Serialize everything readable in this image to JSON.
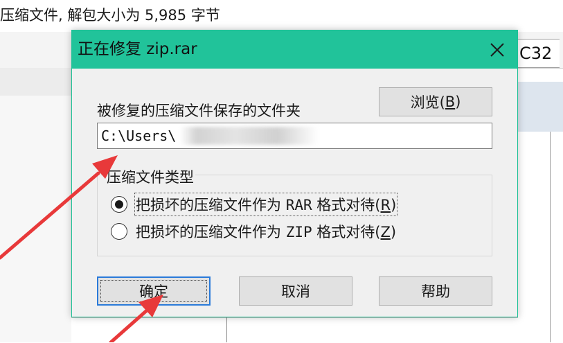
{
  "background": {
    "status_text": "压缩文件, 解包大小为 5,985 字节",
    "crc_column": "C32"
  },
  "dialog": {
    "title": "正在修复 zip.rar",
    "close_icon": "close-icon",
    "folder_label": "被修复的压缩文件保存的文件夹",
    "browse_button": {
      "label": "浏览(",
      "accel": "B",
      "suffix": ")"
    },
    "path_value": "C:\\Users\\",
    "archive_type": {
      "legend": "压缩文件类型",
      "options": [
        {
          "label": "把损坏的压缩文件作为 ",
          "format": "RAR",
          "rest": " 格式对待(",
          "accel": "R",
          "suffix": ")",
          "selected": true
        },
        {
          "label": "把损坏的压缩文件作为 ",
          "format": "ZIP",
          "rest": " 格式对待(",
          "accel": "Z",
          "suffix": ")",
          "selected": false
        }
      ]
    },
    "buttons": {
      "ok": "确定",
      "cancel": "取消",
      "help": "帮助"
    }
  },
  "colors": {
    "titlebar": "#21c39a",
    "dialog_bg": "#f0f0f0",
    "focus_border": "#2a7ad9",
    "annotation_arrow": "#e8393a"
  }
}
